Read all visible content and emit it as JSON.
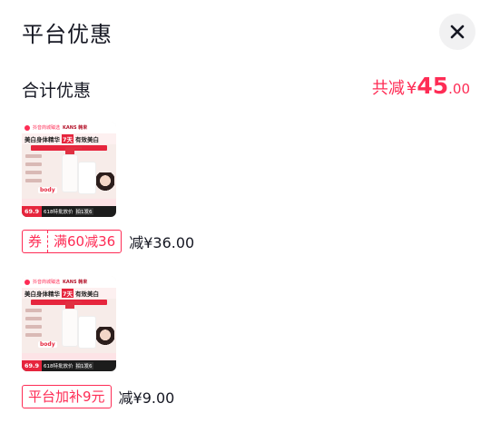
{
  "header": {
    "title": "平台优惠",
    "close_icon": "close-icon"
  },
  "summary": {
    "label": "合计优惠",
    "prefix": "共减",
    "currency": "¥",
    "amount_int": "45",
    "amount_dec": ".00"
  },
  "colors": {
    "accent": "#fe2c55",
    "text": "#161823",
    "close_bg": "#f1f1f2"
  },
  "products": [
    {
      "image": {
        "store": "抖音商城臻选",
        "brand": "KANS 韩束",
        "headline_a": "美白身体精华",
        "headline_b": "7天",
        "headline_c": "有效美白",
        "body_tag": "body",
        "price_label": "69.9",
        "promo_a": "618特批放价",
        "promo_b": "拍1发6"
      },
      "discount": {
        "type": "coupon",
        "kind": "券",
        "condition": "满60减36",
        "amount_text": "减¥36.00"
      }
    },
    {
      "image": {
        "store": "抖音商城臻选",
        "brand": "KANS 韩束",
        "headline_a": "美白身体精华",
        "headline_b": "7天",
        "headline_c": "有效美白",
        "body_tag": "body",
        "price_label": "69.9",
        "promo_a": "618特批放价",
        "promo_b": "拍1发6"
      },
      "discount": {
        "type": "platform",
        "label": "平台加补9元",
        "amount_text": "减¥9.00"
      }
    }
  ]
}
